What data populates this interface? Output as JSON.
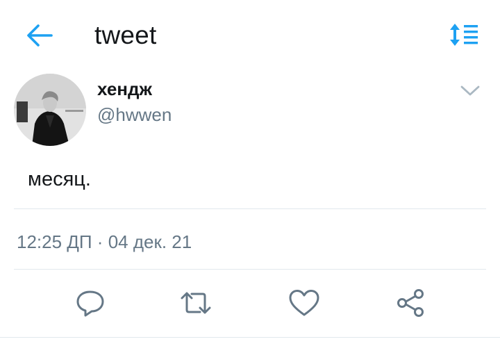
{
  "header": {
    "title": "tweet",
    "back_icon": "arrow-left-icon",
    "sort_icon": "sort-icon"
  },
  "tweet": {
    "display_name": "хендж",
    "handle": "@hwwen",
    "text": "месяц.",
    "timestamp": "12:25 ДП · 04 дек. 21"
  },
  "actions": [
    {
      "name": "reply",
      "icon": "reply-icon"
    },
    {
      "name": "retweet",
      "icon": "retweet-icon"
    },
    {
      "name": "like",
      "icon": "heart-icon"
    },
    {
      "name": "share",
      "icon": "share-icon"
    }
  ],
  "colors": {
    "accent": "#1da1f2",
    "text_primary": "#14171a",
    "text_secondary": "#657786",
    "divider": "#e1e8ed"
  }
}
